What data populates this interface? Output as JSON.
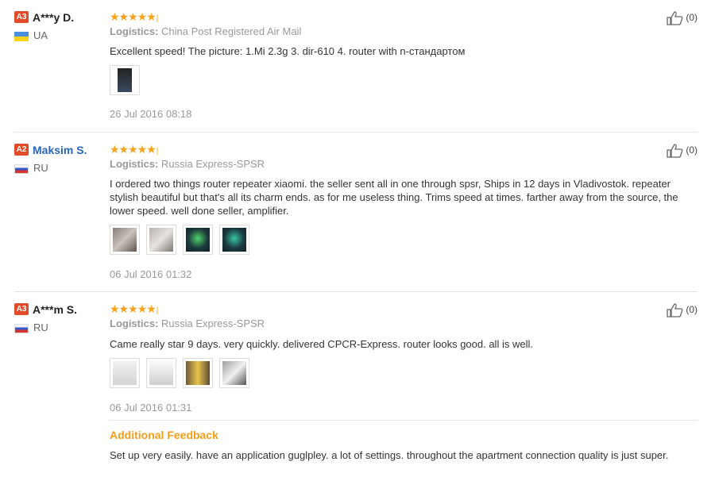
{
  "reviews": [
    {
      "badge": "A3",
      "name": "A***y D.",
      "country": "UA",
      "logistics_label": "Logistics:",
      "logistics_value": "China Post Registered Air Mail",
      "text": "Excellent speed! The picture: 1.Mi 2.3g 3. dir-610 4. router with n-стандартом",
      "date": "26 Jul 2016 08:18",
      "helpful": "(0)",
      "rating_stars": 5
    },
    {
      "badge": "A2",
      "name": "Maksim S.",
      "country": "RU",
      "logistics_label": "Logistics:",
      "logistics_value": "Russia Express-SPSR",
      "text": "I ordered two things router repeater xiaomi. the seller sent all in one through spsr, Ships in 12 days in Vladivostok. repeater stylish beautiful but that's all its charm ends. as for me useless thing. Trims speed at times. farther away from the source, the lower speed. well done seller, amplifier.",
      "date": "06 Jul 2016 01:32",
      "helpful": "(0)",
      "rating_stars": 5
    },
    {
      "badge": "A3",
      "name": "A***m S.",
      "country": "RU",
      "logistics_label": "Logistics:",
      "logistics_value": "Russia Express-SPSR",
      "text": "Came really star 9 days. very quickly. delivered CPCR-Express. router looks good. all is well.",
      "date": "06 Jul 2016 01:31",
      "helpful": "(0)",
      "rating_stars": 5
    }
  ],
  "additional_feedback": {
    "title": "Additional Feedback",
    "text": "Set up very easily. have an application guglpley. a lot of settings. throughout the apartment connection quality is just super."
  },
  "stars_glyph": "★★★★★",
  "colors": {
    "star": "#f7a21a",
    "badge": "#e24b2a",
    "accent": "#f39e1a",
    "link": "#2a66b8"
  }
}
